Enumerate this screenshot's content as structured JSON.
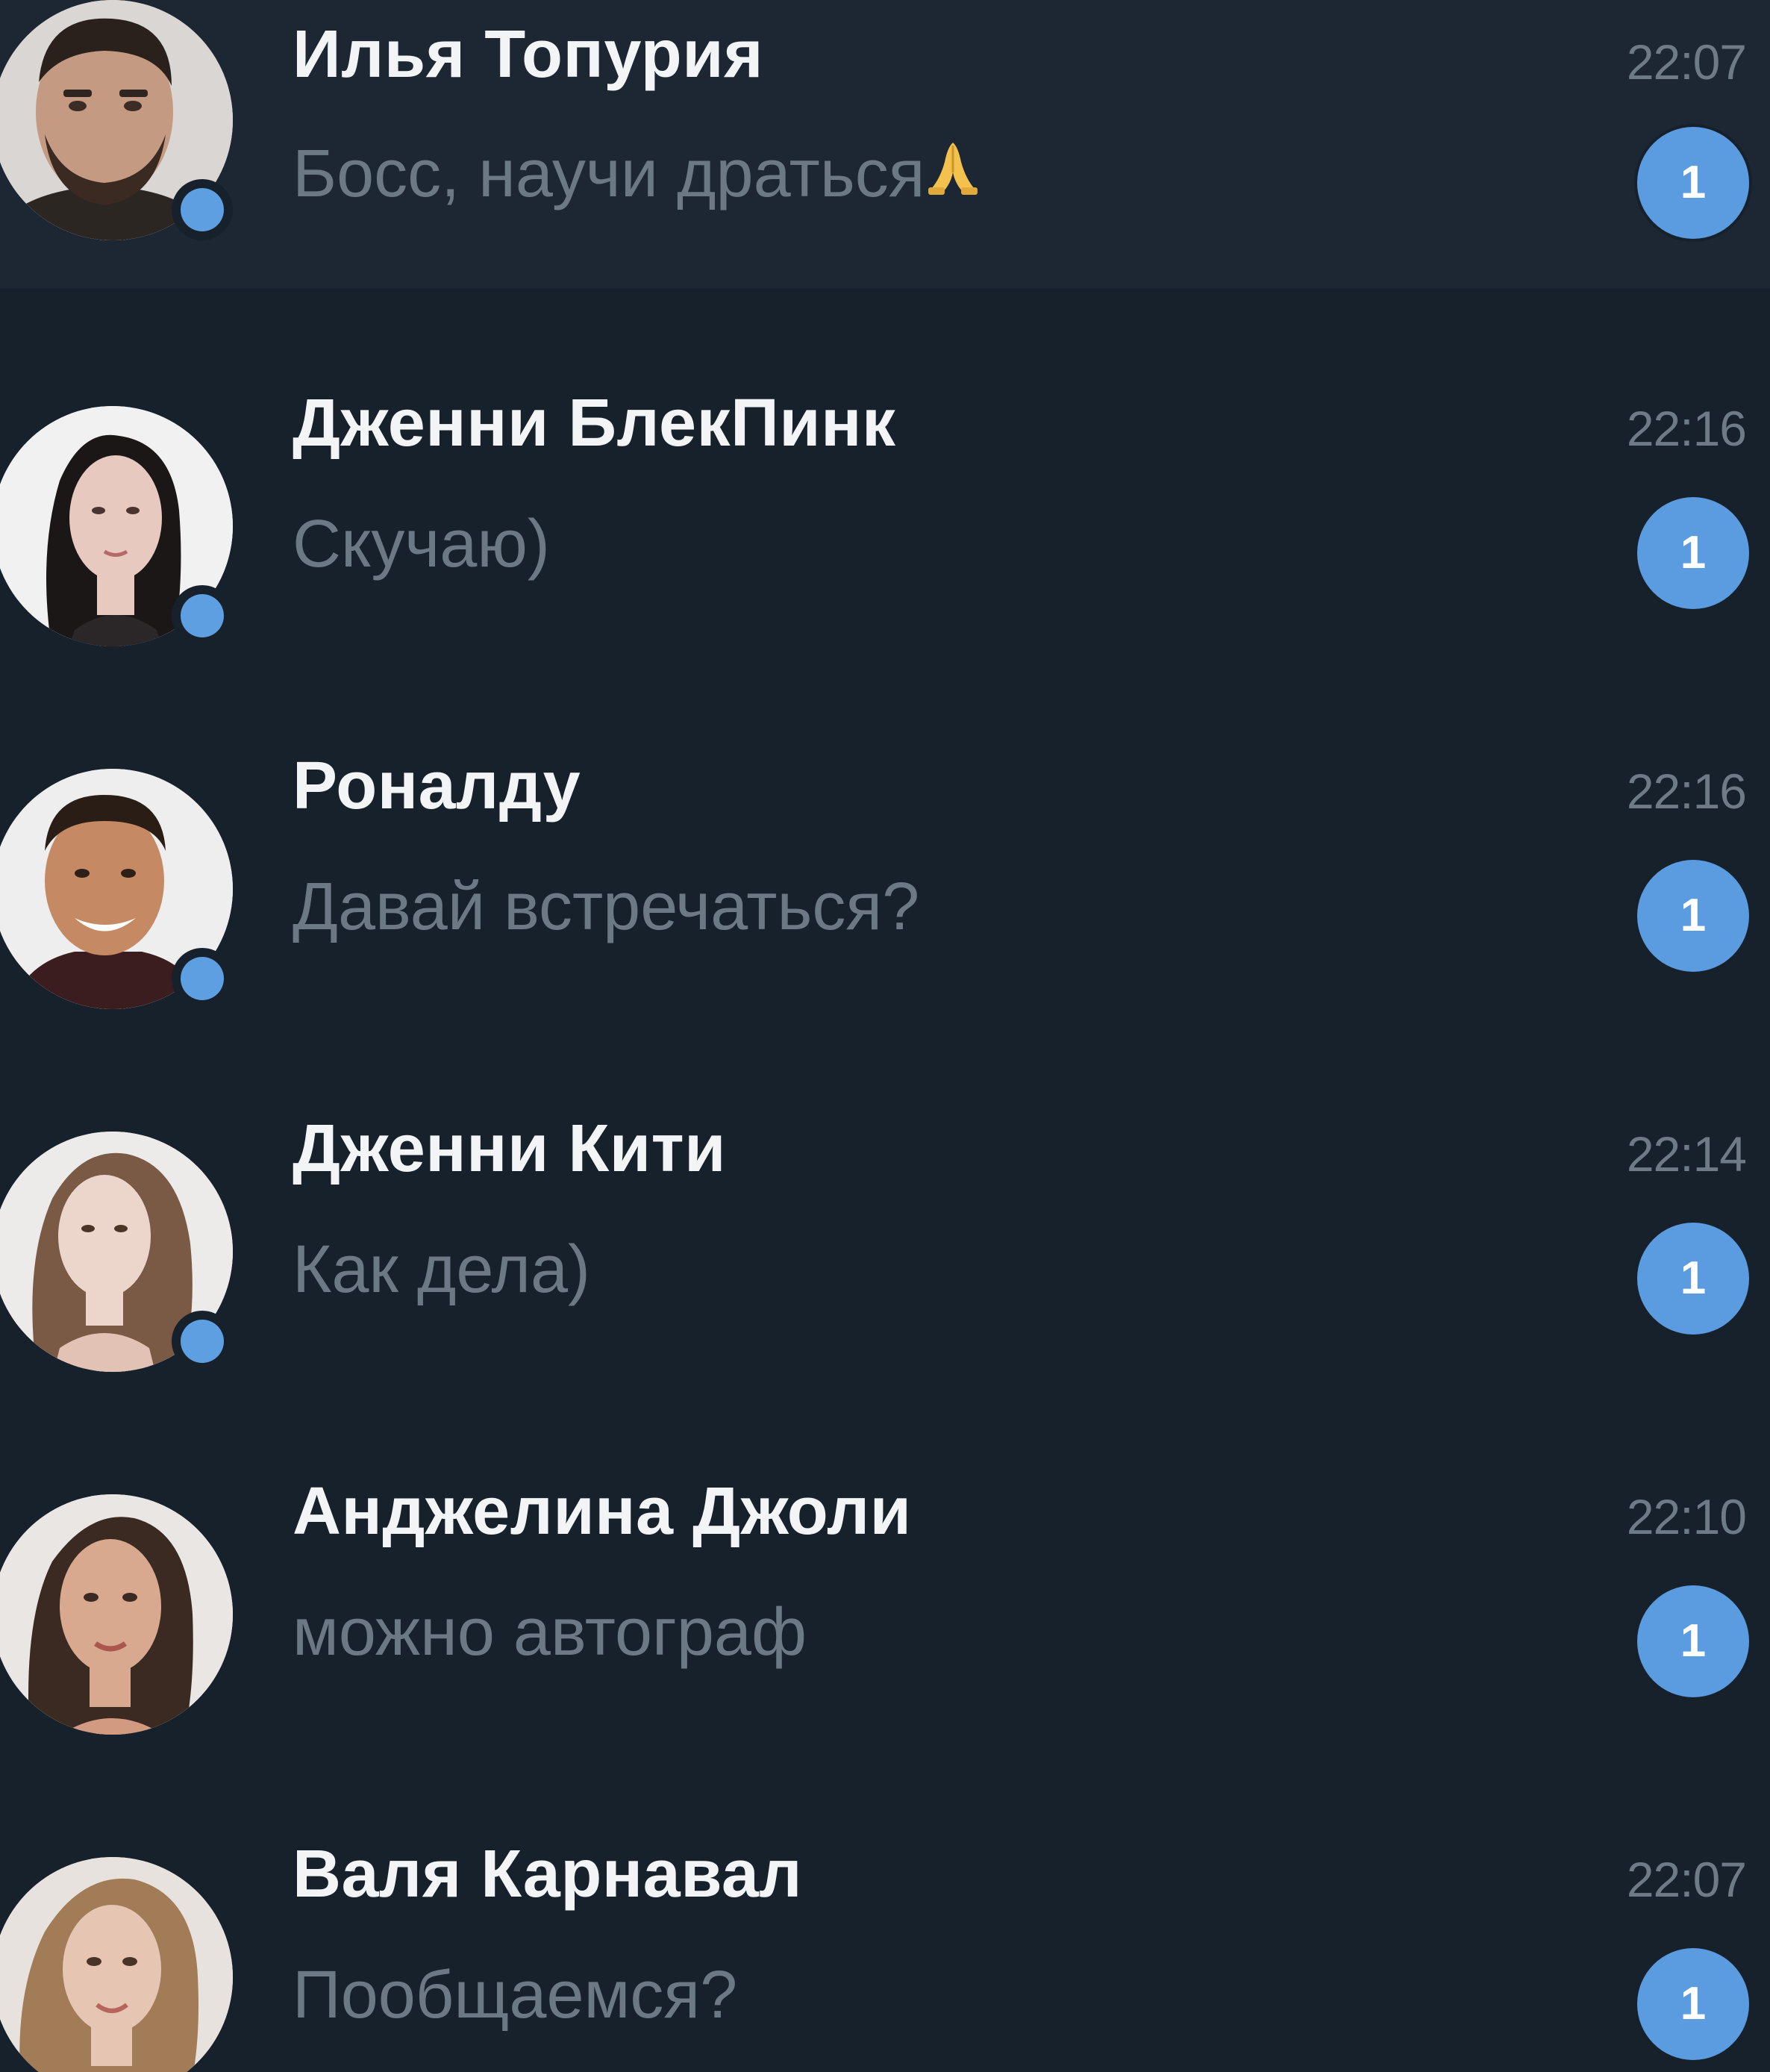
{
  "chats": [
    {
      "name": "Илья Топурия",
      "preview": "Босс, научи драться",
      "preview_emoji": "folded-hands-icon",
      "time": "22:07",
      "unread": "1",
      "online": true,
      "avatar": "avatar-man-beard"
    },
    {
      "name": "Дженни БлекПинк",
      "preview": "Скучаю)",
      "time": "22:16",
      "unread": "1",
      "online": true,
      "avatar": "avatar-woman-dark-hair"
    },
    {
      "name": "Роналду",
      "preview": "Давай встречаться?",
      "time": "22:16",
      "unread": "1",
      "online": true,
      "avatar": "avatar-man-smiling"
    },
    {
      "name": "Дженни Кити",
      "preview": "Как дела)",
      "time": "22:14",
      "unread": "1",
      "online": true,
      "avatar": "avatar-woman-brown-hair"
    },
    {
      "name": "Анджелина Джоли",
      "preview": "можно автограф",
      "time": "22:10",
      "unread": "1",
      "online": false,
      "avatar": "avatar-woman-long-hair"
    },
    {
      "name": "Валя Карнавал",
      "preview": "Пообщаемся?",
      "time": "22:07",
      "unread": "1",
      "online": false,
      "avatar": "avatar-woman-curly-hair"
    }
  ],
  "colors": {
    "background": "#17212b",
    "name": "#f2f4f6",
    "preview": "#6c7883",
    "time": "#6e7b86",
    "badge": "#5b9be0",
    "online_dot": "#5d9fe0"
  }
}
